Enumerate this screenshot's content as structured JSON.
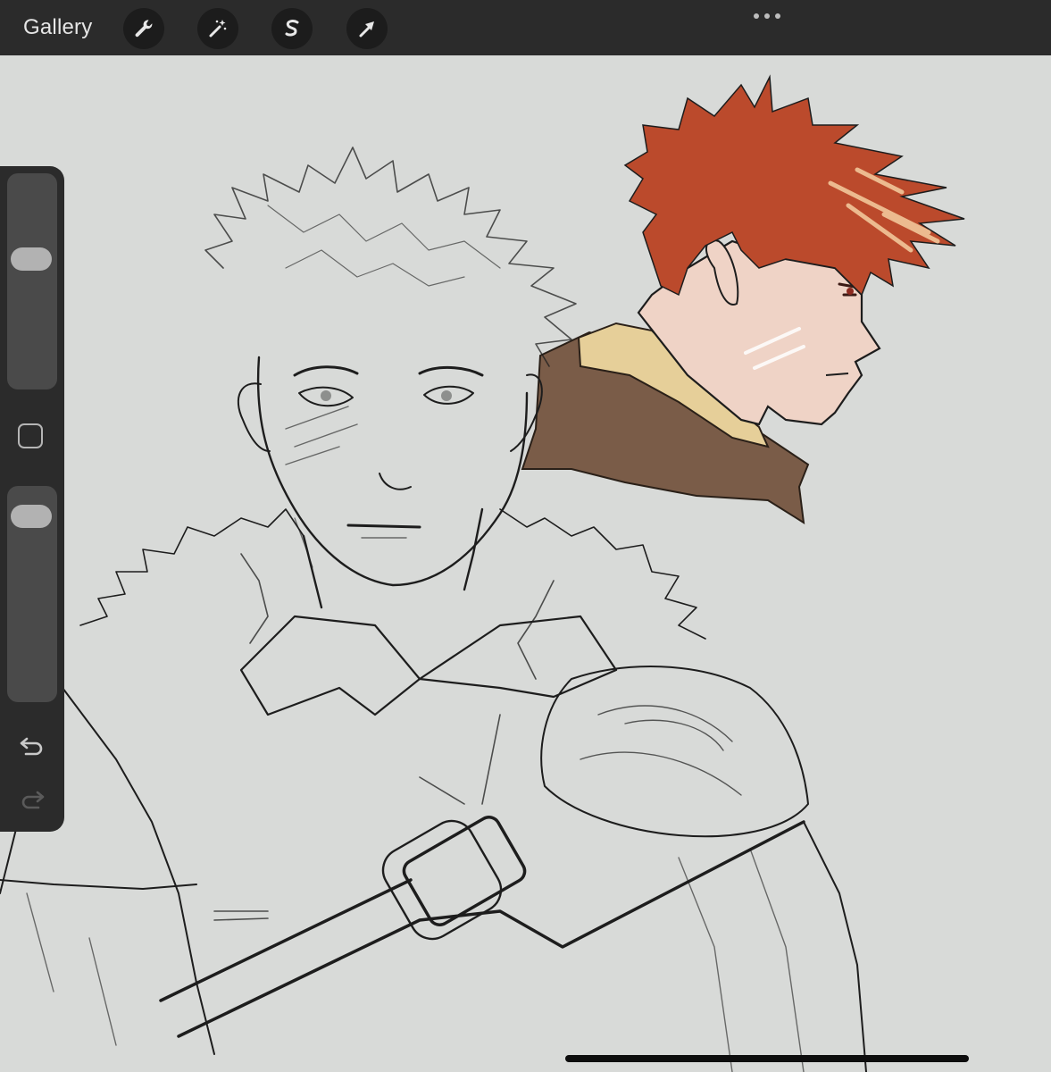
{
  "app": {
    "gallery_label": "Gallery"
  },
  "toolbar": {
    "icons": [
      "wrench-icon",
      "magic-wand-icon",
      "selection-s-icon",
      "move-arrow-icon"
    ],
    "more_icon": "ellipsis-icon"
  },
  "sidebar": {
    "brush_size_level": 0.62,
    "opacity_level": 0.08,
    "icons": [
      "square-modify-icon",
      "undo-icon",
      "redo-icon"
    ]
  },
  "colors": {
    "toolbar_bg": "#2b2b2b",
    "canvas_bg": "#d8dad8",
    "hair": "#bb4a2c",
    "hair_highlight": "#f2c79a",
    "skin": "#efd3c6",
    "fur_collar": "#7a5c48",
    "undershirt": "#e6cf99",
    "line": "#1d1d1d"
  }
}
